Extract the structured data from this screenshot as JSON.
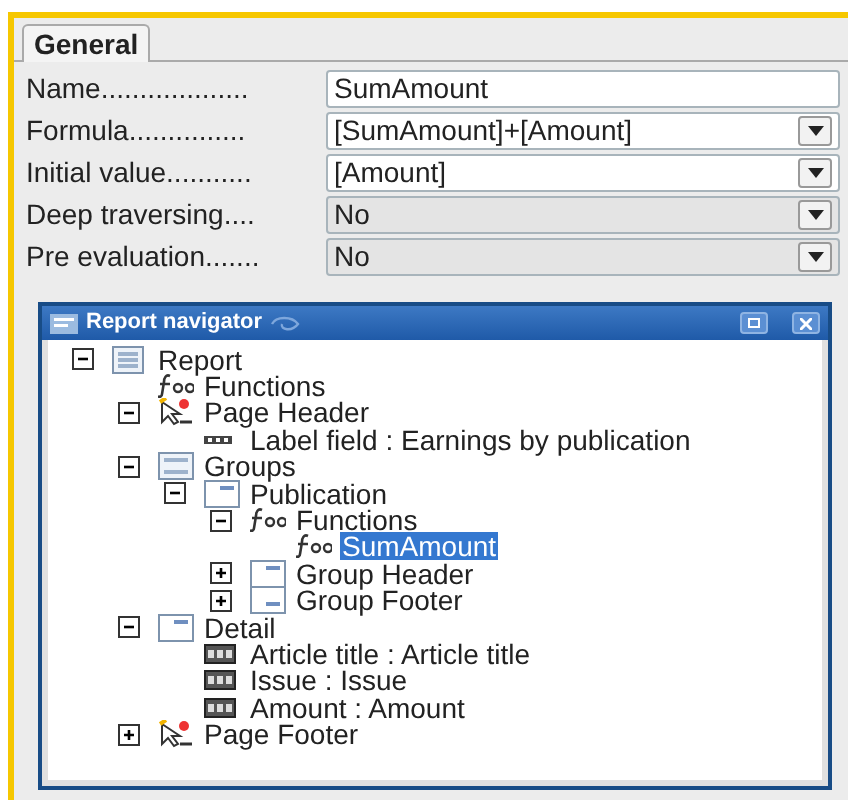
{
  "tabs": [
    {
      "label": "General",
      "selected": true
    }
  ],
  "fields": [
    {
      "label": "Name...................",
      "kind": "text",
      "value": "SumAmount"
    },
    {
      "label": "Formula...............",
      "kind": "editable-combo",
      "value": "[SumAmount]+[Amount]"
    },
    {
      "label": "Initial value...........",
      "kind": "editable-combo",
      "value": "[Amount]"
    },
    {
      "label": "Deep traversing....",
      "kind": "combo",
      "value": "No"
    },
    {
      "label": "Pre evaluation.......",
      "kind": "combo",
      "value": "No"
    }
  ],
  "navigator": {
    "title": "Report navigator",
    "tree": [
      {
        "label": "Report",
        "kind": "report",
        "expanded": true,
        "selected": false,
        "children": [
          {
            "label": "Functions",
            "kind": "function",
            "selected": false
          },
          {
            "label": "Page Header",
            "kind": "page-band",
            "expanded": true,
            "selected": false,
            "children": [
              {
                "label": "Label field : Earnings by publication",
                "kind": "label",
                "selected": false
              }
            ]
          },
          {
            "label": "Groups",
            "kind": "groups",
            "expanded": true,
            "selected": false,
            "children": [
              {
                "label": "Publication",
                "kind": "group",
                "expanded": true,
                "selected": false,
                "children": [
                  {
                    "label": "Functions",
                    "kind": "function",
                    "expanded": true,
                    "selected": false,
                    "children": [
                      {
                        "label": "SumAmount",
                        "kind": "function",
                        "selected": true
                      }
                    ]
                  },
                  {
                    "label": "Group Header",
                    "kind": "group-header",
                    "expanded": false,
                    "selected": false
                  },
                  {
                    "label": "Group Footer",
                    "kind": "group-footer",
                    "expanded": false,
                    "selected": false
                  }
                ]
              }
            ]
          },
          {
            "label": "Detail",
            "kind": "detail",
            "expanded": true,
            "selected": false,
            "children": [
              {
                "label": "Article title : Article title",
                "kind": "text-field",
                "selected": false
              },
              {
                "label": "Issue : Issue",
                "kind": "text-field",
                "selected": false
              },
              {
                "label": "Amount : Amount",
                "kind": "text-field",
                "selected": false
              }
            ]
          },
          {
            "label": "Page Footer",
            "kind": "page-band",
            "expanded": false,
            "selected": false
          }
        ]
      }
    ]
  }
}
